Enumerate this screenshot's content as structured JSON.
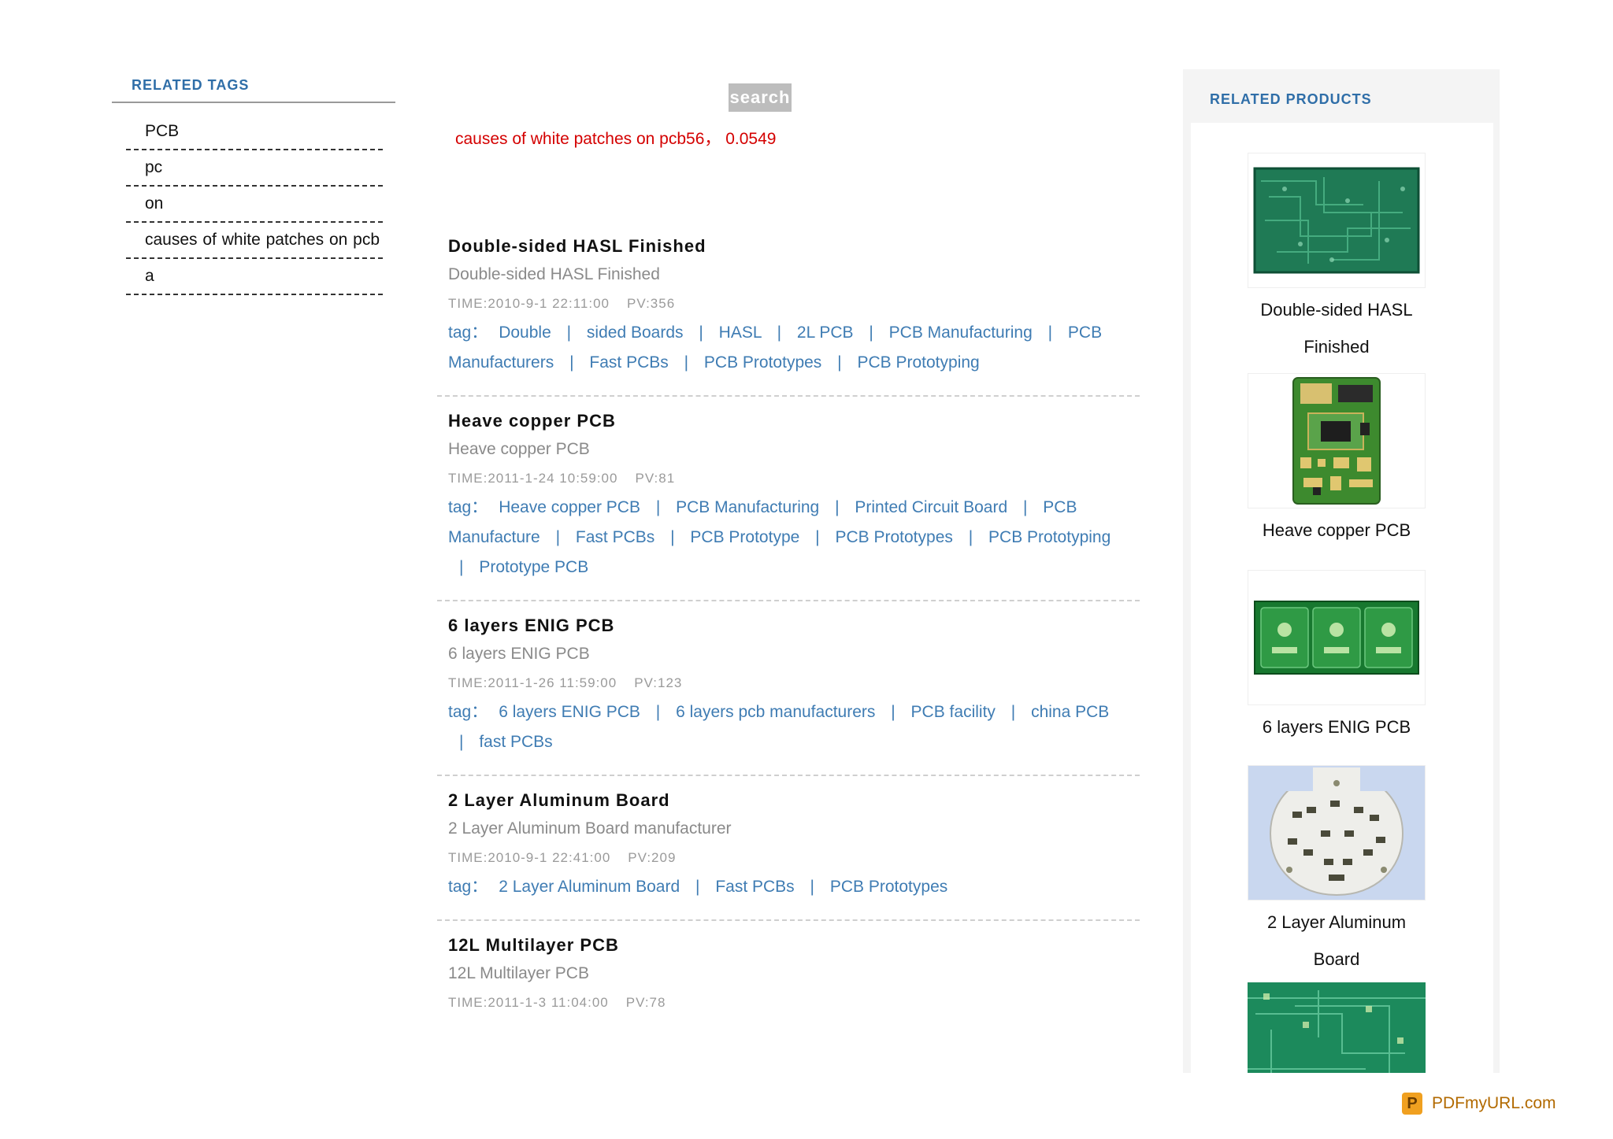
{
  "sidebar": {
    "title": "RELATED TAGS",
    "tags": [
      "PCB",
      "pc",
      "on",
      "causes of white patches on pcb",
      "a"
    ]
  },
  "search": {
    "button_label": "search",
    "result_query": "causes of white patches on pcb56",
    "result_sep": "，",
    "result_time": "0.0549"
  },
  "articles": [
    {
      "title": "Double-sided HASL Finished",
      "desc": "Double-sided HASL Finished",
      "time": "TIME:2010-9-1 22:11:00",
      "pv": "PV:356",
      "tag_label": "tag：",
      "tags": [
        "Double",
        "sided Boards",
        "HASL",
        "2L PCB",
        "PCB Manufacturing",
        "PCB Manufacturers",
        "Fast PCBs",
        "PCB Prototypes",
        "PCB Prototyping"
      ]
    },
    {
      "title": "Heave copper PCB",
      "desc": "Heave copper PCB",
      "time": "TIME:2011-1-24 10:59:00",
      "pv": "PV:81",
      "tag_label": "tag：",
      "tags": [
        "Heave copper PCB",
        "PCB Manufacturing",
        "Printed Circuit Board",
        "PCB Manufacture",
        "Fast PCBs",
        "PCB Prototype",
        "PCB Prototypes",
        "PCB Prototyping",
        "Prototype PCB"
      ]
    },
    {
      "title": "6 layers ENIG PCB",
      "desc": "6 layers ENIG PCB",
      "time": "TIME:2011-1-26 11:59:00",
      "pv": "PV:123",
      "tag_label": "tag：",
      "tags": [
        "6 layers ENIG PCB",
        "6 layers pcb manufacturers",
        "PCB facility",
        "china PCB",
        "fast PCBs"
      ]
    },
    {
      "title": "2 Layer Aluminum Board",
      "desc": "2 Layer Aluminum Board manufacturer",
      "time": "TIME:2010-9-1 22:41:00",
      "pv": "PV:209",
      "tag_label": "tag：",
      "tags": [
        "2 Layer Aluminum Board",
        "Fast PCBs",
        "PCB Prototypes"
      ]
    },
    {
      "title": "12L Multilayer PCB",
      "desc": "12L Multilayer PCB",
      "time": "TIME:2011-1-3 11:04:00",
      "pv": "PV:78",
      "tag_label": "",
      "tags": []
    }
  ],
  "tag_separator": "|",
  "products": {
    "title": "RELATED PRODUCTS",
    "items": [
      {
        "name": "Double-sided HASL Finished",
        "icon": "pcb-board-green-image"
      },
      {
        "name": "Heave copper PCB",
        "icon": "pcb-board-phone-image"
      },
      {
        "name": "6 layers ENIG PCB",
        "icon": "pcb-board-triple-image"
      },
      {
        "name": "2 Layer Aluminum Board",
        "icon": "aluminum-led-board-image"
      },
      {
        "name": "",
        "icon": "pcb-multilayer-image"
      }
    ]
  },
  "footer": {
    "badge_text": "PDFmyURL.com"
  },
  "colors": {
    "link": "#3f7cb3",
    "section_title": "#2f6ea8",
    "result_red": "#d40000"
  }
}
